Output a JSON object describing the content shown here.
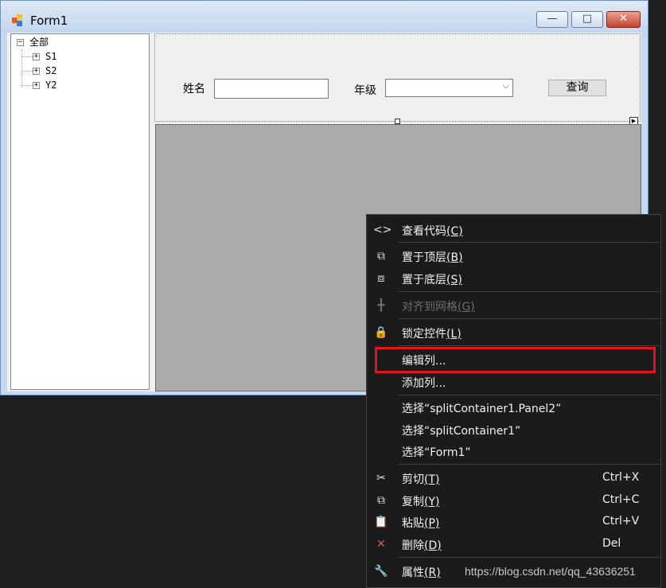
{
  "window": {
    "title": "Form1",
    "buttons": {
      "minimize": "—",
      "maximize": "□",
      "close": "✕"
    }
  },
  "tree": {
    "root": {
      "label": "全部",
      "expander": "−"
    },
    "children": [
      {
        "label": "S1",
        "expander": "+"
      },
      {
        "label": "S2",
        "expander": "+"
      },
      {
        "label": "Y2",
        "expander": "+"
      }
    ]
  },
  "search_panel": {
    "name_label": "姓名",
    "name_value": "",
    "grade_label": "年级",
    "grade_value": "",
    "query_button": "查询"
  },
  "context_menu": {
    "items": [
      {
        "icon": "code-icon",
        "glyph": "<>",
        "label": "查看代码",
        "mnemonic": "(C)",
        "shortcut": "",
        "disabled": false
      },
      {
        "icon": "bring-to-front-icon",
        "glyph": "⧉",
        "label": "置于顶层",
        "mnemonic": "(B)",
        "shortcut": "",
        "disabled": false
      },
      {
        "icon": "send-to-back-icon",
        "glyph": "⧈",
        "label": "置于底层",
        "mnemonic": "(S)",
        "shortcut": "",
        "disabled": false
      },
      {
        "icon": "align-grid-icon",
        "glyph": "╋",
        "label": "对齐到网格",
        "mnemonic": "(G)",
        "shortcut": "",
        "disabled": true
      },
      {
        "icon": "lock-icon",
        "glyph": "🔒",
        "label": "锁定控件",
        "mnemonic": "(L)",
        "shortcut": "",
        "disabled": false
      },
      {
        "icon": "",
        "glyph": "",
        "label": "编辑列...",
        "mnemonic": "",
        "shortcut": "",
        "disabled": false
      },
      {
        "icon": "",
        "glyph": "",
        "label": "添加列...",
        "mnemonic": "",
        "shortcut": "",
        "disabled": false
      },
      {
        "icon": "",
        "glyph": "",
        "label": "选择“splitContainer1.Panel2”",
        "mnemonic": "",
        "shortcut": "",
        "disabled": false
      },
      {
        "icon": "",
        "glyph": "",
        "label": "选择“splitContainer1”",
        "mnemonic": "",
        "shortcut": "",
        "disabled": false
      },
      {
        "icon": "",
        "glyph": "",
        "label": "选择“Form1”",
        "mnemonic": "",
        "shortcut": "",
        "disabled": false
      },
      {
        "icon": "cut-icon",
        "glyph": "✂",
        "label": "剪切",
        "mnemonic": "(T)",
        "shortcut": "Ctrl+X",
        "disabled": false
      },
      {
        "icon": "copy-icon",
        "glyph": "⧉",
        "label": "复制",
        "mnemonic": "(Y)",
        "shortcut": "Ctrl+C",
        "disabled": false
      },
      {
        "icon": "paste-icon",
        "glyph": "📋",
        "label": "粘贴",
        "mnemonic": "(P)",
        "shortcut": "Ctrl+V",
        "disabled": false
      },
      {
        "icon": "delete-icon",
        "glyph": "✕",
        "label": "删除",
        "mnemonic": "(D)",
        "shortcut": "Del",
        "disabled": false
      },
      {
        "icon": "properties-icon",
        "glyph": "🔧",
        "label": "属性",
        "mnemonic": "(R)",
        "shortcut": "",
        "disabled": false
      }
    ]
  },
  "colors": {
    "delete_icon": "#e8524a",
    "highlight_border": "#e0161c",
    "menu_background": "#1b1b1c"
  },
  "watermark": "https://blog.csdn.net/qq_43636251"
}
